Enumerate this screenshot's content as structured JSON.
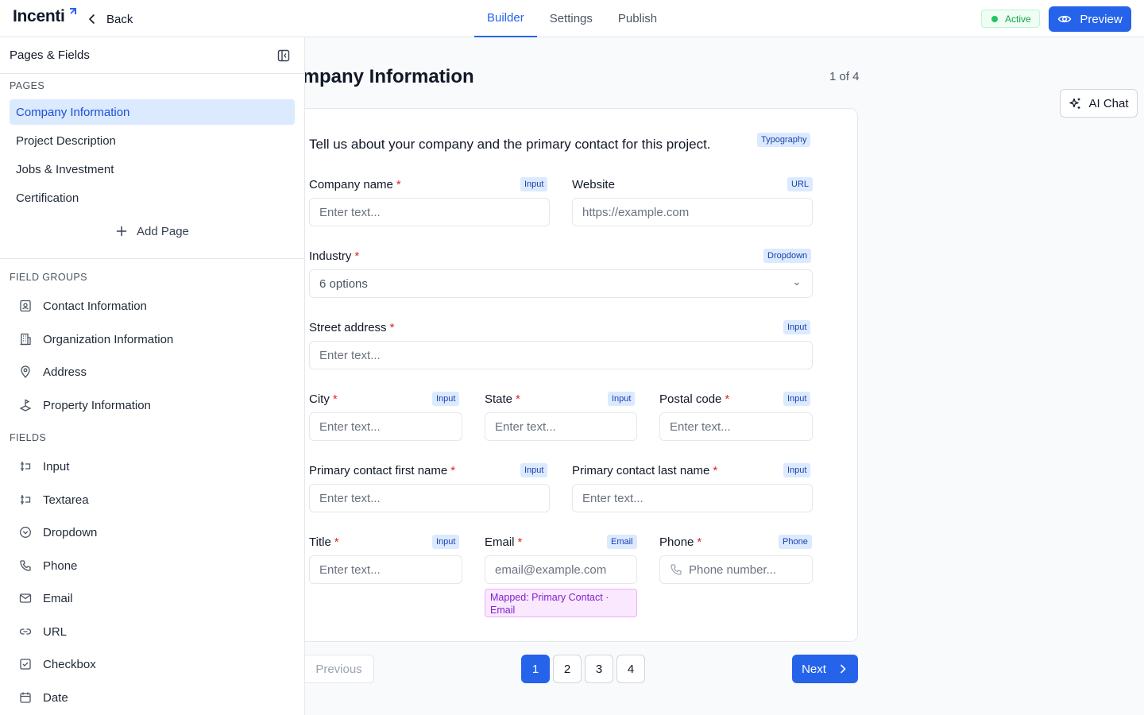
{
  "header": {
    "logo_text": "Incenti",
    "back_label": "Back",
    "tabs": [
      {
        "label": "Builder",
        "active": true
      },
      {
        "label": "Settings",
        "active": false
      },
      {
        "label": "Publish",
        "active": false
      }
    ],
    "status_label": "Active",
    "preview_label": "Preview"
  },
  "sidebar": {
    "title": "Pages & Fields",
    "pages_heading": "PAGES",
    "pages": [
      "Company Information",
      "Project Description",
      "Jobs & Investment",
      "Certification"
    ],
    "add_page_label": "Add Page",
    "field_groups_heading": "FIELD GROUPS",
    "field_groups": [
      {
        "label": "Contact Information",
        "icon": "contact-card-icon"
      },
      {
        "label": "Organization Information",
        "icon": "building-icon"
      },
      {
        "label": "Address",
        "icon": "map-pin-icon"
      },
      {
        "label": "Property Information",
        "icon": "land-plot-icon"
      }
    ],
    "fields_heading": "FIELDS",
    "fields": [
      {
        "label": "Input",
        "icon": "text-cursor-input-icon"
      },
      {
        "label": "Textarea",
        "icon": "text-cursor-input-icon"
      },
      {
        "label": "Dropdown",
        "icon": "chevron-circle-icon"
      },
      {
        "label": "Phone",
        "icon": "phone-icon"
      },
      {
        "label": "Email",
        "icon": "mail-icon"
      },
      {
        "label": "URL",
        "icon": "link-icon"
      },
      {
        "label": "Checkbox",
        "icon": "checkbox-icon"
      },
      {
        "label": "Date",
        "icon": "calendar-icon"
      }
    ]
  },
  "main": {
    "page_title": "ompany Information",
    "page_counter": "1 of 4",
    "ai_chat_label": "AI Chat",
    "intro_text": "Tell us about your company and the primary contact for this project.",
    "intro_tag": "Typography",
    "fields": {
      "company_name": {
        "label": "Company name",
        "tag": "Input",
        "placeholder": "Enter text..."
      },
      "website": {
        "label": "Website",
        "tag": "URL",
        "placeholder": "https://example.com"
      },
      "industry": {
        "label": "Industry",
        "tag": "Dropdown",
        "value": "6 options"
      },
      "street_address": {
        "label": "Street address",
        "tag": "Input",
        "placeholder": "Enter text..."
      },
      "city": {
        "label": "City",
        "tag": "Input",
        "placeholder": "Enter text..."
      },
      "state": {
        "label": "State",
        "tag": "Input",
        "placeholder": "Enter text..."
      },
      "postal_code": {
        "label": "Postal code",
        "tag": "Input",
        "placeholder": "Enter text..."
      },
      "first_name": {
        "label": "Primary contact first name",
        "tag": "Input",
        "placeholder": "Enter text..."
      },
      "last_name": {
        "label": "Primary contact last name",
        "tag": "Input",
        "placeholder": "Enter text..."
      },
      "title": {
        "label": "Title",
        "tag": "Input",
        "placeholder": "Enter text..."
      },
      "email": {
        "label": "Email",
        "tag": "Email",
        "placeholder": "email@example.com",
        "mapped": "Mapped: Primary Contact · Email"
      },
      "phone": {
        "label": "Phone",
        "tag": "Phone",
        "placeholder": "Phone number..."
      }
    },
    "required_mark": "*"
  },
  "pagination": {
    "previous_label": "Previous",
    "pages": [
      "1",
      "2",
      "3",
      "4"
    ],
    "current": "1",
    "next_label": "Next"
  },
  "colors": {
    "accent": "#2563eb",
    "active_status": "#16a34a",
    "required": "#dc2626",
    "mapped_bg": "#fae8ff",
    "mapped_text": "#7e22ce"
  }
}
